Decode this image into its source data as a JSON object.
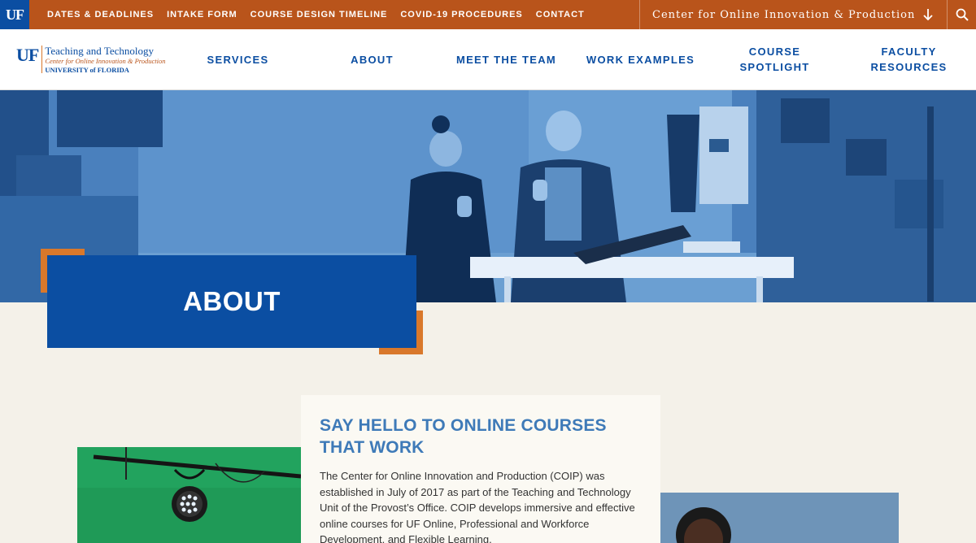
{
  "topbar": {
    "logo": "UF",
    "links": [
      "DATES & DEADLINES",
      "INTAKE FORM",
      "COURSE DESIGN TIMELINE",
      "COVID-19 PROCEDURES",
      "CONTACT"
    ],
    "unit_selector": "Center for Online Innovation & Production",
    "icons": [
      "arrow-down-icon",
      "search-icon"
    ]
  },
  "brand": {
    "mark": "UF",
    "title": "Teaching and Technology",
    "subtitle": "Center for Online Innovation & Production",
    "university": "UNIVERSITY of FLORIDA"
  },
  "nav": {
    "items": [
      "SERVICES",
      "ABOUT",
      "MEET THE TEAM",
      "WORK EXAMPLES",
      "COURSE SPOTLIGHT",
      "FACULTY RESOURCES"
    ]
  },
  "hero": {
    "title": "ABOUT"
  },
  "intro": {
    "heading": "SAY HELLO TO ONLINE COURSES THAT WORK",
    "body": "The Center for Online Innovation and Production (COIP) was established in July of 2017 as part of the Teaching and Technology Unit of the Provost’s Office. COIP develops immersive and effective online courses for UF Online, Professional and Workforce Development, and Flexible Learning."
  },
  "colors": {
    "brand_orange": "#b9541b",
    "accent_orange": "#d9782b",
    "brand_blue": "#0b4ea2",
    "heading_blue": "#3e7ab8"
  }
}
